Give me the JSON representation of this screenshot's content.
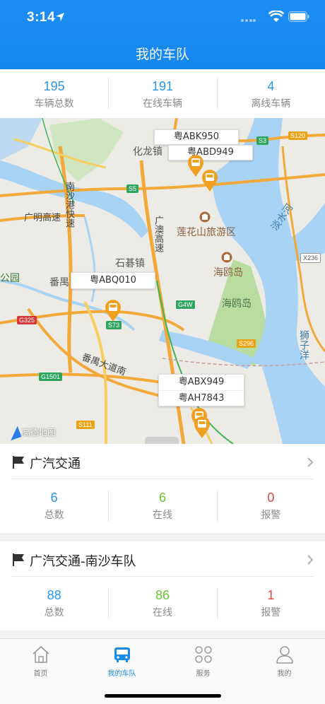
{
  "status_bar": {
    "time": "3:14"
  },
  "nav": {
    "title": "我的车队"
  },
  "summary": [
    {
      "value": "195",
      "label": "车辆总数"
    },
    {
      "value": "191",
      "label": "在线车辆"
    },
    {
      "value": "4",
      "label": "离线车辆"
    }
  ],
  "map": {
    "labels": {
      "hualong": "化龙镇",
      "nansha_gangkuai": "南沙港快速",
      "guangming": "广明高速",
      "guangao": "广澳高速",
      "lianhuashan": "莲花山旅游区",
      "shiqi": "石碁镇",
      "haiou_dao": "海鸥岛",
      "haiou_dao2": "海鸥岛",
      "panyu": "番禺",
      "gongyuan": "公园",
      "panyu_dadao": "番禺大道南",
      "shizi": "狮子洋",
      "danshui": "淡水河"
    },
    "roads": {
      "s5": "S5",
      "s3": "S3",
      "s120": "S120",
      "g4w": "G4W",
      "s73": "S73",
      "g325": "G325",
      "g1501": "G1501",
      "s296": "S296",
      "s111": "S111",
      "x236": "X236"
    },
    "vehicles": [
      "粤ABK950",
      "粤ABD949",
      "粤ABQ010",
      "粤ABX949",
      "粤AH7843"
    ],
    "attribution": "高德地图"
  },
  "fleets": [
    {
      "name": "广汽交通",
      "stats": [
        {
          "value": "6",
          "label": "总数"
        },
        {
          "value": "6",
          "label": "在线"
        },
        {
          "value": "0",
          "label": "报警"
        }
      ]
    },
    {
      "name": "广汽交通-南沙车队",
      "stats": [
        {
          "value": "88",
          "label": "总数"
        },
        {
          "value": "86",
          "label": "在线"
        },
        {
          "value": "1",
          "label": "报警"
        }
      ]
    }
  ],
  "tabs": [
    {
      "label": "首页",
      "icon": "home-icon"
    },
    {
      "label": "我的车队",
      "icon": "bus-icon"
    },
    {
      "label": "服务",
      "icon": "grid-icon"
    },
    {
      "label": "我的",
      "icon": "person-icon"
    }
  ],
  "colors": {
    "primary": "#1a8be8",
    "online": "#6ac52e",
    "alarm": "#d9483b",
    "marker": "#f0a020"
  }
}
